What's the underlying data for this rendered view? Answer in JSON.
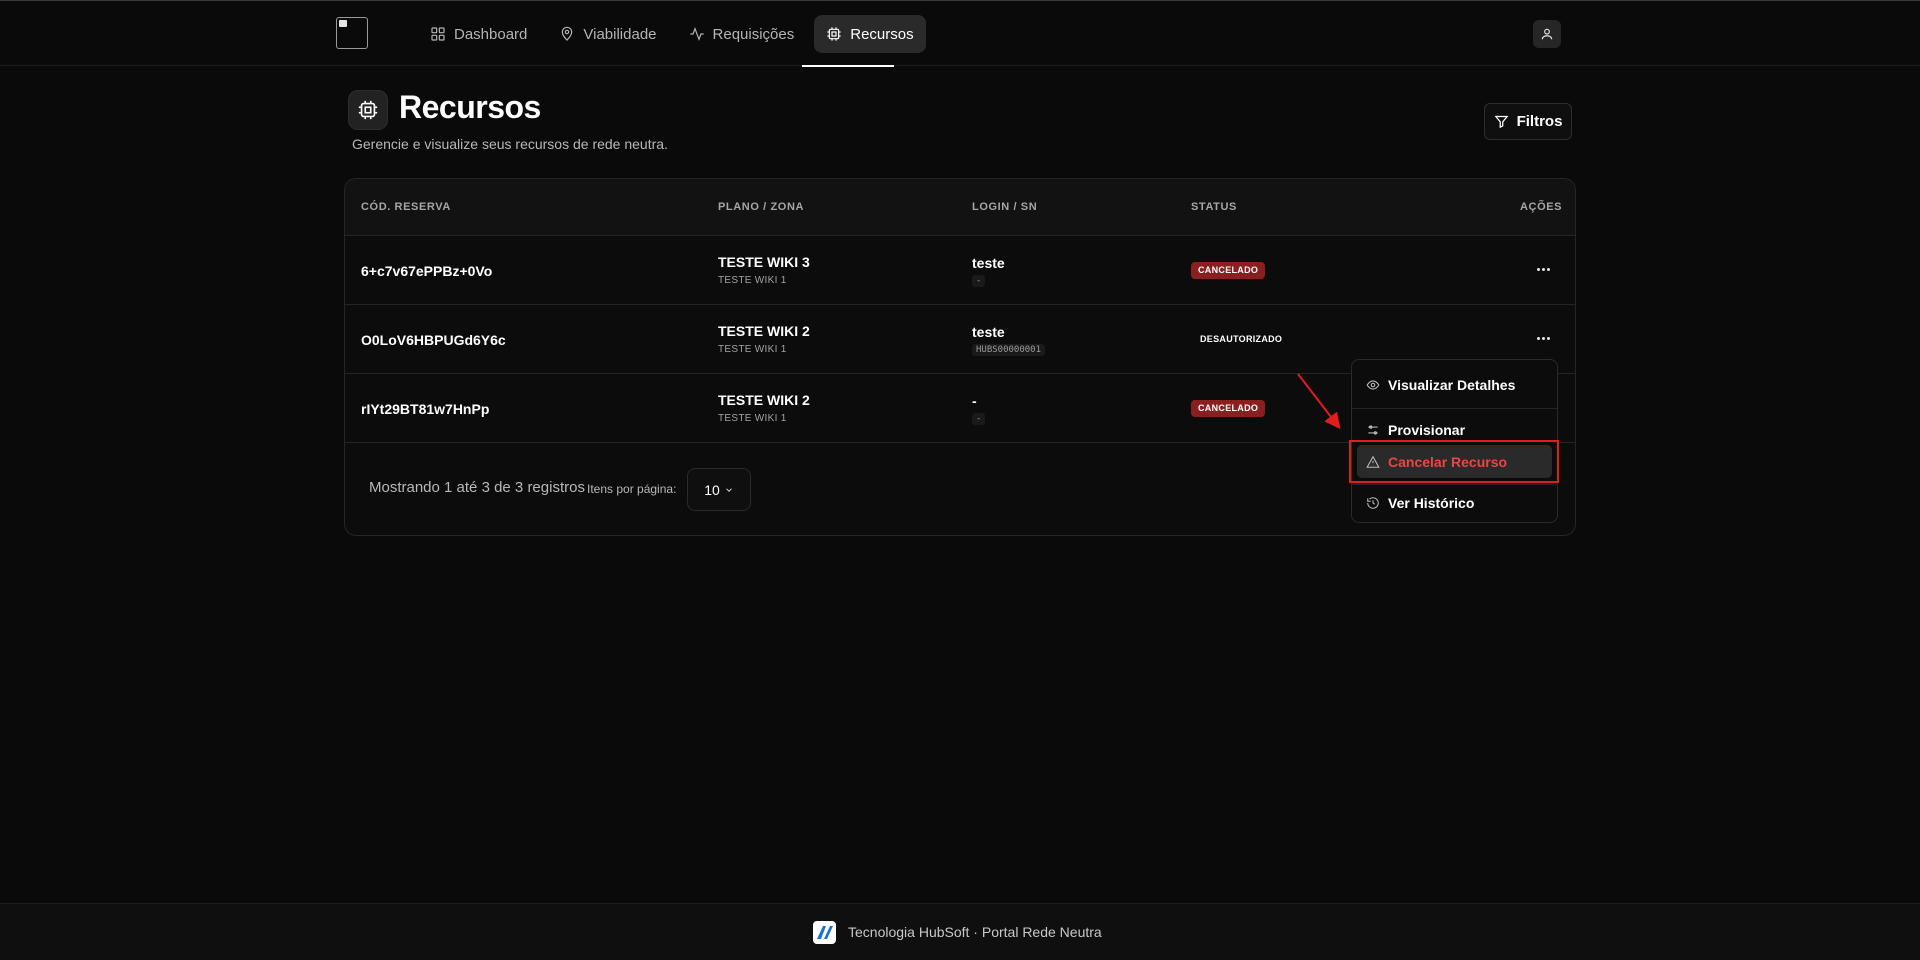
{
  "nav": {
    "items": [
      {
        "label": "Dashboard",
        "icon": "grid-icon"
      },
      {
        "label": "Viabilidade",
        "icon": "map-pin-icon"
      },
      {
        "label": "Requisições",
        "icon": "activity-icon"
      },
      {
        "label": "Recursos",
        "icon": "cpu-icon",
        "active": true
      }
    ]
  },
  "header": {
    "title": "Recursos",
    "subtitle": "Gerencie e visualize seus recursos de rede neutra.",
    "filters_label": "Filtros"
  },
  "table": {
    "columns": [
      "CÓD. RESERVA",
      "PLANO / ZONA",
      "LOGIN / SN",
      "STATUS",
      "AÇÕES"
    ],
    "rows": [
      {
        "code": "6+c7v67ePPBz+0Vo",
        "plan": "TESTE WIKI 3",
        "zone": "TESTE WIKI 1",
        "login": "teste",
        "sn": "-",
        "status": "CANCELADO",
        "status_color": "#8b1f1f"
      },
      {
        "code": "O0LoV6HBPUGd6Y6c",
        "plan": "TESTE WIKI 2",
        "zone": "TESTE WIKI 1",
        "login": "teste",
        "sn": "HUBS00000001",
        "status": "DESAUTORIZADO",
        "status_color": "transparent"
      },
      {
        "code": "rIYt29BT81w7HnPp",
        "plan": "TESTE WIKI 2",
        "zone": "TESTE WIKI 1",
        "login": "-",
        "sn": "-",
        "status": "CANCELADO",
        "status_color": "#8b1f1f"
      }
    ]
  },
  "pagination": {
    "summary": "Mostrando 1 até 3 de 3 registros",
    "per_page_label": "Itens por página:",
    "per_page_value": "10"
  },
  "actions_menu": {
    "items": [
      {
        "label": "Visualizar Detalhes",
        "icon": "eye-icon"
      },
      {
        "label": "Provisionar",
        "icon": "sliders-icon"
      },
      {
        "label": "Cancelar Recurso",
        "icon": "alert-triangle-icon",
        "danger": true
      },
      {
        "label": "Ver Histórico",
        "icon": "history-icon"
      }
    ]
  },
  "footer": {
    "text": "Tecnologia HubSoft · Portal Rede Neutra"
  },
  "colors": {
    "background": "#0a0a0a",
    "danger": "#ef4444",
    "annotation": "#e11d1d"
  }
}
